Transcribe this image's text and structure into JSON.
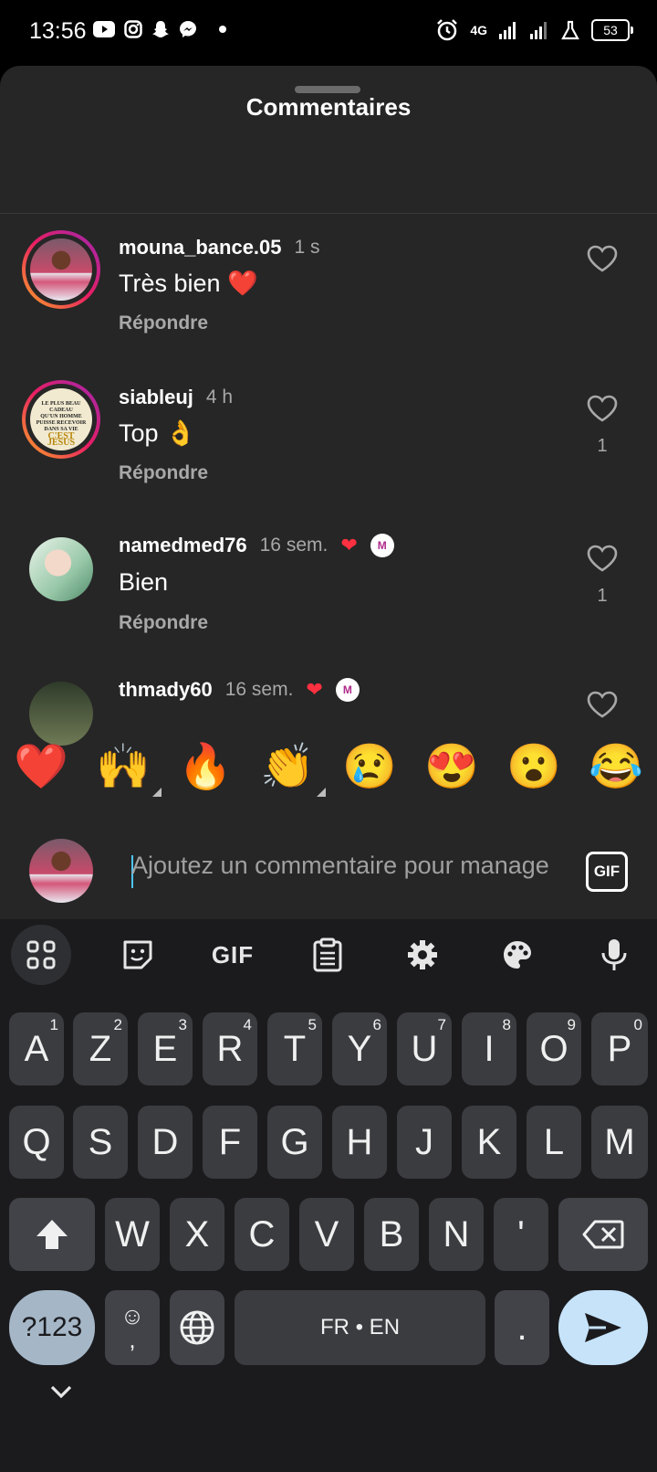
{
  "status_bar": {
    "time": "13:56",
    "network": "4G",
    "battery": "53",
    "left_icons": [
      "youtube-icon",
      "instagram-icon",
      "snapchat-icon",
      "messenger-icon",
      "dot-icon"
    ],
    "right_icons": [
      "alarm-icon",
      "signal-icon",
      "signal-icon",
      "lab-icon"
    ]
  },
  "sheet": {
    "title": "Commentaires"
  },
  "comments": [
    {
      "username": "mouna_bance.05",
      "time": "1 s",
      "text": "Très bien ❤️",
      "reply": "Répondre",
      "likes": ""
    },
    {
      "username": "siableuj",
      "time": "4 h",
      "text": "Top 👌",
      "reply": "Répondre",
      "likes": "1",
      "avatar_text": [
        "LE PLUS BEAU CADEAU",
        "QU'UN HOMME PUISSE RECEVOIR",
        "DANS SA VIE",
        "C'EST JÉSUS"
      ]
    },
    {
      "username": "namedmed76",
      "time": "16 sem.",
      "text": "Bien",
      "reply": "Répondre",
      "likes": "1",
      "badge": "M"
    },
    {
      "username": "thmady60",
      "time": "16 sem.",
      "text": "",
      "reply": "",
      "likes": "",
      "badge": "M"
    }
  ],
  "emoji_bar": [
    "❤️",
    "🙌",
    "🔥",
    "👏",
    "😢",
    "😍",
    "😮",
    "😂"
  ],
  "comment_input": {
    "placeholder": "Ajoutez un commentaire pour manage",
    "gif_label": "GIF"
  },
  "keyboard": {
    "toolbar": {
      "gif_label": "GIF"
    },
    "row1": [
      {
        "k": "A",
        "n": "1"
      },
      {
        "k": "Z",
        "n": "2"
      },
      {
        "k": "E",
        "n": "3"
      },
      {
        "k": "R",
        "n": "4"
      },
      {
        "k": "T",
        "n": "5"
      },
      {
        "k": "Y",
        "n": "6"
      },
      {
        "k": "U",
        "n": "7"
      },
      {
        "k": "I",
        "n": "8"
      },
      {
        "k": "O",
        "n": "9"
      },
      {
        "k": "P",
        "n": "0"
      }
    ],
    "row2": [
      "Q",
      "S",
      "D",
      "F",
      "G",
      "H",
      "J",
      "K",
      "L",
      "M"
    ],
    "row3": [
      "W",
      "X",
      "C",
      "V",
      "B",
      "N",
      "'"
    ],
    "symbols_key": "?123",
    "emoji_key_sub": ",",
    "space_label": "FR • EN",
    "period_key": "."
  },
  "colors": {
    "sheet_bg": "#262626",
    "keyboard_bg": "#1b1b1e",
    "like_red": "#ff3040",
    "send_key": "#c6e3fa"
  }
}
